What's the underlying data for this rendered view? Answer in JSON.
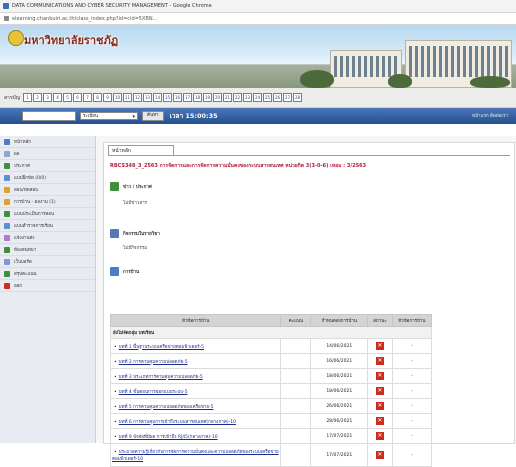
{
  "window": {
    "title": "DATA COMMUNICATIONS AND CYBER SECURITY MANAGEMENT - Google Chrome"
  },
  "address": {
    "url": "elearning.chanbuiri.ac.th/class_index.php?id=cid=5XBN..."
  },
  "banner": {
    "university": "มหาวิทยาลัยราชภัฏ"
  },
  "menu": {
    "label": "สารบัญ",
    "buttons": [
      "1",
      "2",
      "3",
      "4",
      "5",
      "6",
      "7",
      "8",
      "9",
      "10",
      "11",
      "12",
      "13",
      "14",
      "15",
      "16",
      "17",
      "18",
      "19",
      "20",
      "21",
      "22",
      "23",
      "24",
      "25",
      "26",
      "27",
      "28"
    ]
  },
  "toolbar": {
    "select_value": "ระเบียน",
    "go_label": "ค้นหา",
    "time": "เวลา 15:00:35",
    "right_text": "หน้าแรก ติดต่อเรา"
  },
  "sidebar": {
    "items": [
      {
        "label": "หน้าหลัก"
      },
      {
        "label": "ผล"
      },
      {
        "label": "ประกาศ"
      },
      {
        "label": "แบบฝึกหัด (0/0)"
      },
      {
        "label": "สอบ/ทดสอบ"
      },
      {
        "label": "การบ้าน - ผลงาน (1)"
      },
      {
        "label": "แบบประเมินการสอน"
      },
      {
        "label": "แบบสำรวจการเรียน"
      },
      {
        "label": "แจ้งงานส่ง"
      },
      {
        "label": "ห้องสนทนา"
      },
      {
        "label": "เว็บบอร์ด"
      },
      {
        "label": "สรุปคะแนน"
      },
      {
        "label": "ออก"
      }
    ]
  },
  "main": {
    "tab": "หน้าหลัก",
    "course_title": "RBCS348_3_2563 การจัดการและการจัดการความมั่นคงของระบบสารสนเทศ หน่วยกิต 3(3-0-6) เทอม : 3/2563",
    "news": {
      "heading": "ข่าว / ประกาศ",
      "empty": "ไม่มีข่าวสาร"
    },
    "activity": {
      "heading": "กิจกรรมในรายวิชา",
      "empty": "ไม่มีกิจกรรม"
    },
    "homework": {
      "heading": "การบ้าน"
    },
    "table": {
      "headers": {
        "title": "หัวข้อการบ้าน",
        "points": "คะแนน",
        "due": "กำหนดส่งการบ้าน",
        "status": "สถานะ",
        "result": "หัวข้อการบ้าน"
      },
      "unit_label": "ยังไม่จัดกลุ่ม บทเรียน",
      "rows": [
        {
          "title": "บทที่ 1 พื้นฐานระบบเครือข่ายคอมพิวเตอร์-5",
          "due": "14/06/2021",
          "result": "-"
        },
        {
          "title": "บทที่ 2 การควบคุมความปลอดภัย-5",
          "due": "16/06/2021",
          "result": "-"
        },
        {
          "title": "บทที่ 3 ประเภทการควบคุมความปลอดภัย-5",
          "due": "18/06/2021",
          "result": "-"
        },
        {
          "title": "บทที่ 4 ขั้นตอนการออกแบบระบบ-5",
          "due": "18/06/2021",
          "result": "-"
        },
        {
          "title": "บทที่ 5 การควบคุมความปลอดภัยของเครือข่าย-5",
          "due": "26/06/2021",
          "result": "-"
        },
        {
          "title": "บทที่ 6 การควบคุมการเข้าถึงระบบสารสนเทศ(กลางภาค)-10",
          "due": "28/06/2021",
          "result": "-"
        },
        {
          "title": "บทที่ 9 ปัจจัยที่มีผล การเข้าถึง RJ45(กลางภาค)-10",
          "due": "17/07/2021",
          "result": "-"
        },
        {
          "title": "ประมวลความรู้เกี่ยวกับการจัดการความมั่นคงและความปลอดภัยของระบบเครือข่ายคอมพิวเตอร์-10",
          "due": "17/07/2021",
          "result": "-",
          "tall": true
        }
      ]
    }
  },
  "colors": {
    "brand_blue": "#2b5a9e",
    "course_red": "#b0203c",
    "link_blue": "#1a2c90",
    "delete_red": "#cd2a20"
  }
}
